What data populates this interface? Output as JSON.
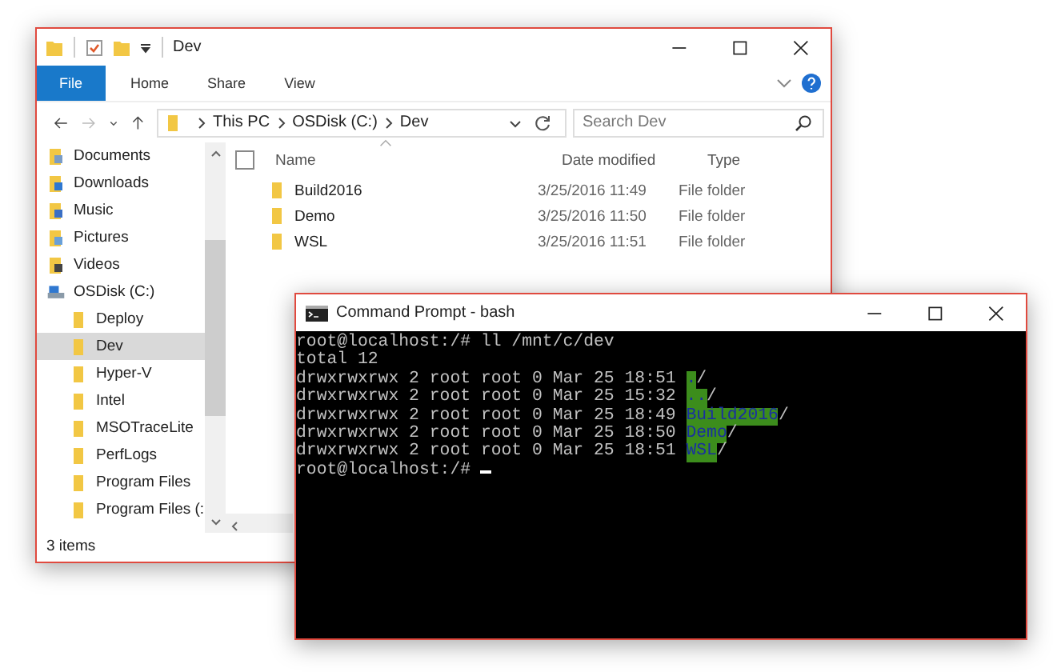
{
  "explorer": {
    "title": "Dev",
    "ribbon_tabs": [
      {
        "label": "File",
        "selected": true
      },
      {
        "label": "Home",
        "selected": false
      },
      {
        "label": "Share",
        "selected": false
      },
      {
        "label": "View",
        "selected": false
      }
    ],
    "breadcrumb": [
      "This PC",
      "OSDisk (C:)",
      "Dev"
    ],
    "search": {
      "placeholder": "Search Dev"
    },
    "sidebar": [
      {
        "label": "Documents",
        "kind": "documents",
        "selected": false
      },
      {
        "label": "Downloads",
        "kind": "downloads",
        "selected": false
      },
      {
        "label": "Music",
        "kind": "music",
        "selected": false
      },
      {
        "label": "Pictures",
        "kind": "pictures",
        "selected": false
      },
      {
        "label": "Videos",
        "kind": "videos",
        "selected": false
      },
      {
        "label": "OSDisk (C:)",
        "kind": "drive",
        "selected": false,
        "children": [
          {
            "label": "Deploy",
            "kind": "folder",
            "selected": false
          },
          {
            "label": "Dev",
            "kind": "folder",
            "selected": true
          },
          {
            "label": "Hyper-V",
            "kind": "folder",
            "selected": false
          },
          {
            "label": "Intel",
            "kind": "folder",
            "selected": false
          },
          {
            "label": "MSOTraceLite",
            "kind": "folder",
            "selected": false
          },
          {
            "label": "PerfLogs",
            "kind": "folder",
            "selected": false
          },
          {
            "label": "Program Files",
            "kind": "folder",
            "selected": false
          },
          {
            "label": "Program Files (:",
            "kind": "folder",
            "selected": false
          }
        ]
      }
    ],
    "select_all": {
      "checked": false
    },
    "columns": [
      "Name",
      "Date modified",
      "Type"
    ],
    "rows": [
      {
        "name": "Build2016",
        "date": "3/25/2016 11:49",
        "type": "File folder"
      },
      {
        "name": "Demo",
        "date": "3/25/2016 11:50",
        "type": "File folder"
      },
      {
        "name": "WSL",
        "date": "3/25/2016 11:51",
        "type": "File folder"
      }
    ],
    "status": "3 items"
  },
  "terminal": {
    "title": "Command Prompt - bash",
    "lines": [
      {
        "kind": "text",
        "text": "root@localhost:/# ll /mnt/c/dev"
      },
      {
        "kind": "text",
        "text": "total 12"
      },
      {
        "kind": "entry",
        "text": "drwxrwxrwx 2 root root 0 Mar 25 18:51 ",
        "name": ".",
        "suffix": "/"
      },
      {
        "kind": "entry",
        "text": "drwxrwxrwx 2 root root 0 Mar 25 15:32 ",
        "name": "..",
        "suffix": "/"
      },
      {
        "kind": "entry",
        "text": "drwxrwxrwx 2 root root 0 Mar 25 18:49 ",
        "name": "Build2016",
        "suffix": "/"
      },
      {
        "kind": "entry",
        "text": "drwxrwxrwx 2 root root 0 Mar 25 18:50 ",
        "name": "Demo",
        "suffix": "/"
      },
      {
        "kind": "entry",
        "text": "drwxrwxrwx 2 root root 0 Mar 25 18:51 ",
        "name": "WSL",
        "suffix": "/"
      },
      {
        "kind": "prompt",
        "text": "root@localhost:/# "
      }
    ]
  }
}
